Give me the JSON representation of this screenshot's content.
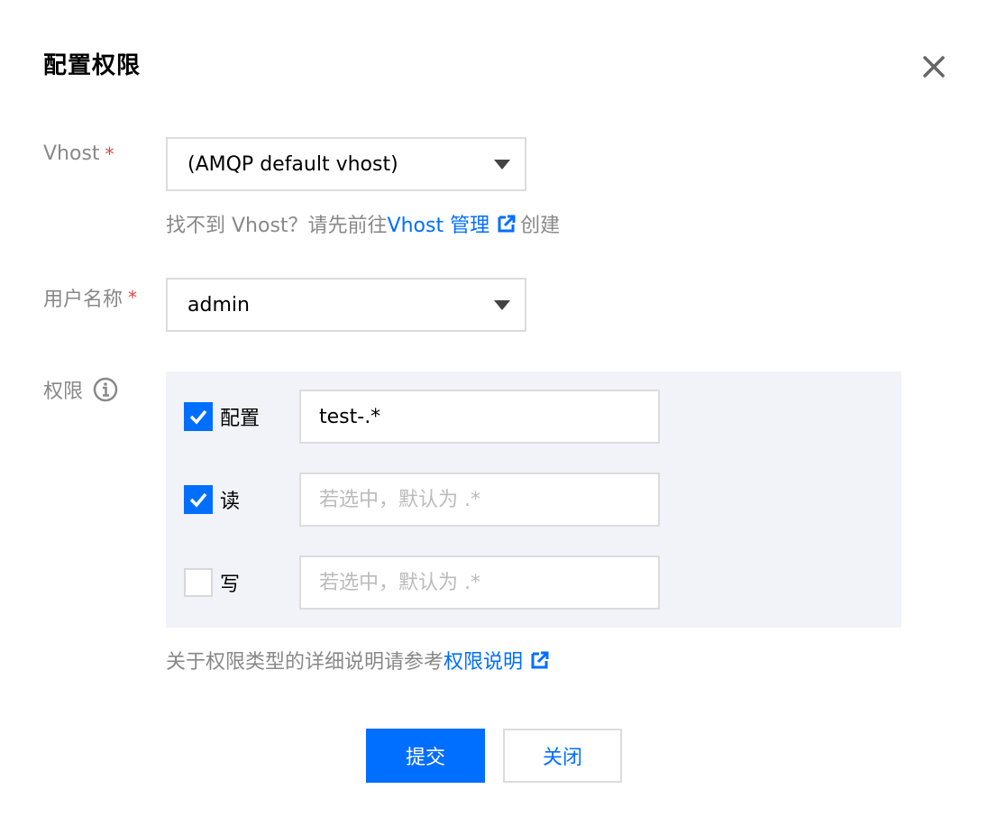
{
  "dialog": {
    "title": "配置权限",
    "close_icon": "close-icon"
  },
  "vhost": {
    "label": "Vhost",
    "required_mark": "*",
    "selected": "(AMQP default vhost)",
    "help_prefix": "找不到 Vhost？请先前往",
    "help_link": "Vhost 管理",
    "help_suffix": "创建"
  },
  "user": {
    "label": "用户名称",
    "required_mark": "*",
    "selected": "admin"
  },
  "permissions": {
    "label": "权限",
    "info_icon": "info-icon",
    "rows": [
      {
        "label": "配置",
        "checked": true,
        "value": "test-.*",
        "placeholder": "若选中，默认为 .*"
      },
      {
        "label": "读",
        "checked": true,
        "value": "",
        "placeholder": "若选中，默认为 .*"
      },
      {
        "label": "写",
        "checked": false,
        "value": "",
        "placeholder": "若选中，默认为 .*"
      }
    ],
    "help_prefix": "关于权限类型的详细说明请参考",
    "help_link": "权限说明"
  },
  "footer": {
    "submit_label": "提交",
    "close_label": "关闭"
  },
  "colors": {
    "accent": "#006eff",
    "required": "#e54545",
    "panel_bg": "#f2f3f8"
  }
}
